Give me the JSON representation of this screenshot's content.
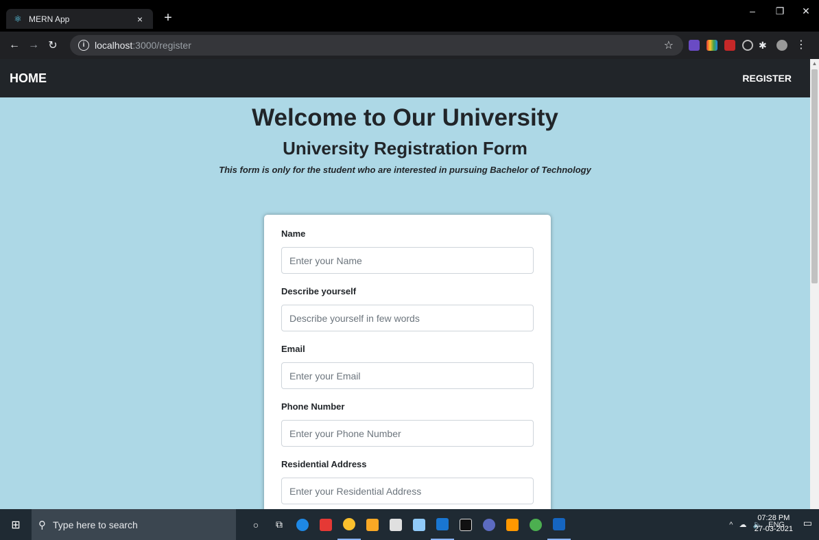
{
  "browser": {
    "tab_title": "MERN App",
    "tab_close": "×",
    "new_tab": "+",
    "url_host": "localhost",
    "url_path": ":3000/register",
    "window_controls": {
      "minimize": "–",
      "restore": "❐",
      "close": "✕"
    }
  },
  "navbar": {
    "brand": "HOME",
    "register_link": "REGISTER"
  },
  "header": {
    "title": "Welcome to Our University",
    "form_title": "University Registration Form",
    "subtitle": "This form is only for the student who are interested in pursuing Bachelor of Technology"
  },
  "form": {
    "fields": [
      {
        "label": "Name",
        "placeholder": "Enter your Name"
      },
      {
        "label": "Describe yourself",
        "placeholder": "Describe yourself in few words"
      },
      {
        "label": "Email",
        "placeholder": "Enter your Email"
      },
      {
        "label": "Phone Number",
        "placeholder": "Enter your Phone Number"
      },
      {
        "label": "Residential Address",
        "placeholder": "Enter your Residential Address"
      }
    ]
  },
  "taskbar": {
    "search_placeholder": "Type here to search",
    "language": "ENG",
    "time": "07:28 PM",
    "date": "27-03-2021"
  },
  "colors": {
    "page_background": "#add8e6",
    "navbar_background": "#212529",
    "browser_chrome": "#202124"
  }
}
